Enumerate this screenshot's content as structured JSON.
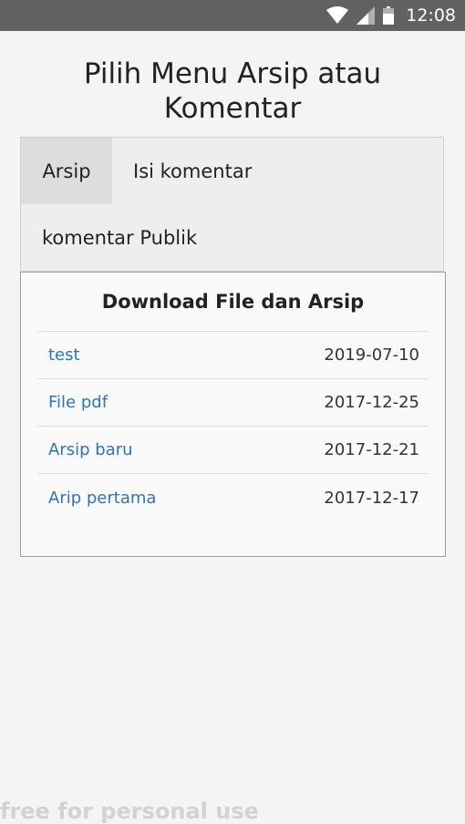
{
  "status_bar": {
    "time": "12:08",
    "icons": [
      "wifi-icon",
      "cellular-signal-icon",
      "battery-icon"
    ]
  },
  "page": {
    "title": "Pilih Menu Arsip atau Komentar"
  },
  "tabs": [
    {
      "label": "Arsip",
      "active": true
    },
    {
      "label": "Isi komentar",
      "active": false
    },
    {
      "label": "komentar Publik",
      "active": false
    }
  ],
  "panel": {
    "title": "Download File dan Arsip",
    "files": [
      {
        "name": "test",
        "date": "2019-07-10"
      },
      {
        "name": "File pdf",
        "date": "2017-12-25"
      },
      {
        "name": "Arsip baru",
        "date": "2017-12-21"
      },
      {
        "name": "Arip pertama",
        "date": "2017-12-17"
      }
    ]
  },
  "watermark": "free for personal use",
  "colors": {
    "status_bar": "#616161",
    "link": "#2f75b5",
    "active_tab": "#dddddd",
    "background": "#f4f4f4"
  }
}
